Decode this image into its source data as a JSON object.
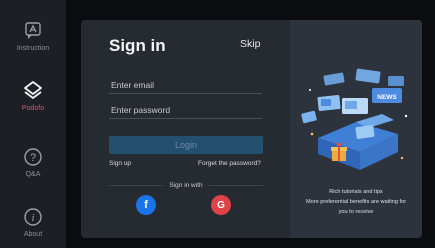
{
  "sidebar": {
    "items": [
      {
        "label": "Instruction",
        "icon": "instruction-icon"
      },
      {
        "label": "Podofo",
        "icon": "podofo-logo-icon",
        "active": true
      },
      {
        "label": "Q&A",
        "icon": "question-icon"
      },
      {
        "label": "About",
        "icon": "info-icon"
      }
    ]
  },
  "signin": {
    "title": "Sign in",
    "skip_label": "Skip",
    "email_placeholder": "Enter email",
    "password_placeholder": "Enter password",
    "login_label": "Login",
    "signup_label": "Sign up",
    "forgot_label": "Forget the password?",
    "sign_in_with_label": "Sign in with",
    "facebook_glyph": "f",
    "google_glyph": "G"
  },
  "promo": {
    "news_badge": "NEWS",
    "line1": "Rich tutorials and tips",
    "line2": "More preferential benefits are waiting for",
    "line3": "you to receive"
  },
  "colors": {
    "accent_active": "#e0536a",
    "login_button": "#23506e",
    "facebook": "#1a73e8",
    "google": "#e04248"
  }
}
